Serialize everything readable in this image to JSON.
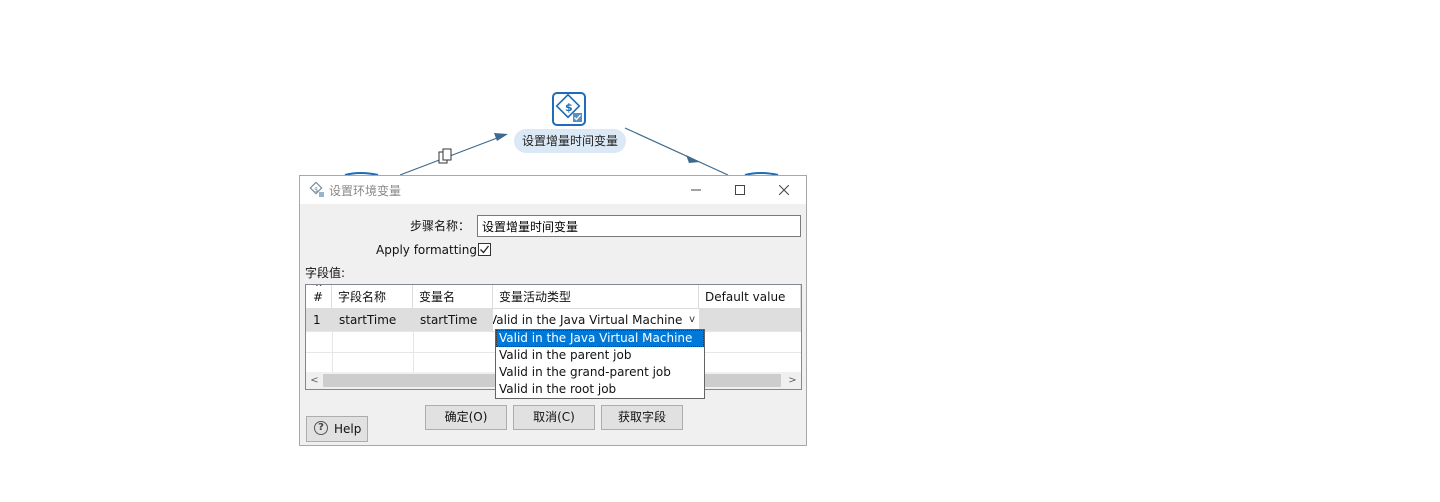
{
  "canvas": {
    "step_label": "设置增量时间变量"
  },
  "dialog": {
    "title": "设置环境变量",
    "window_buttons": {
      "minimize": "—",
      "maximize": "☐",
      "close": "✕"
    },
    "step_name_label": "步骤名称：",
    "step_name_value": "设置增量时间变量",
    "apply_formatting_label": "Apply formatting",
    "apply_formatting_checked": true,
    "fields_label": "字段值:",
    "table": {
      "columns": [
        "#",
        "字段名称",
        "变量名",
        "变量活动类型",
        "Default value"
      ],
      "rows": [
        {
          "num": "1",
          "field": "startTime",
          "variable": "startTime",
          "scope": "Valid in the Java Virtual Machine",
          "default": ""
        }
      ]
    },
    "scope_dropdown": {
      "options": [
        "Valid in the Java Virtual Machine",
        "Valid in the parent job",
        "Valid in the grand-parent job",
        "Valid in the root job"
      ],
      "selected_index": 0
    },
    "buttons": {
      "ok": "确定(O)",
      "cancel": "取消(C)",
      "get_fields": "获取字段",
      "help": "Help"
    },
    "scroll_left": "<",
    "scroll_right": ">",
    "sort_indicator": "^",
    "combo_arrow": "v",
    "help_glyph": "?"
  },
  "colors": {
    "accent": "#0078d7",
    "hop": "#3d6a8e",
    "node_border": "#1e6db6"
  }
}
